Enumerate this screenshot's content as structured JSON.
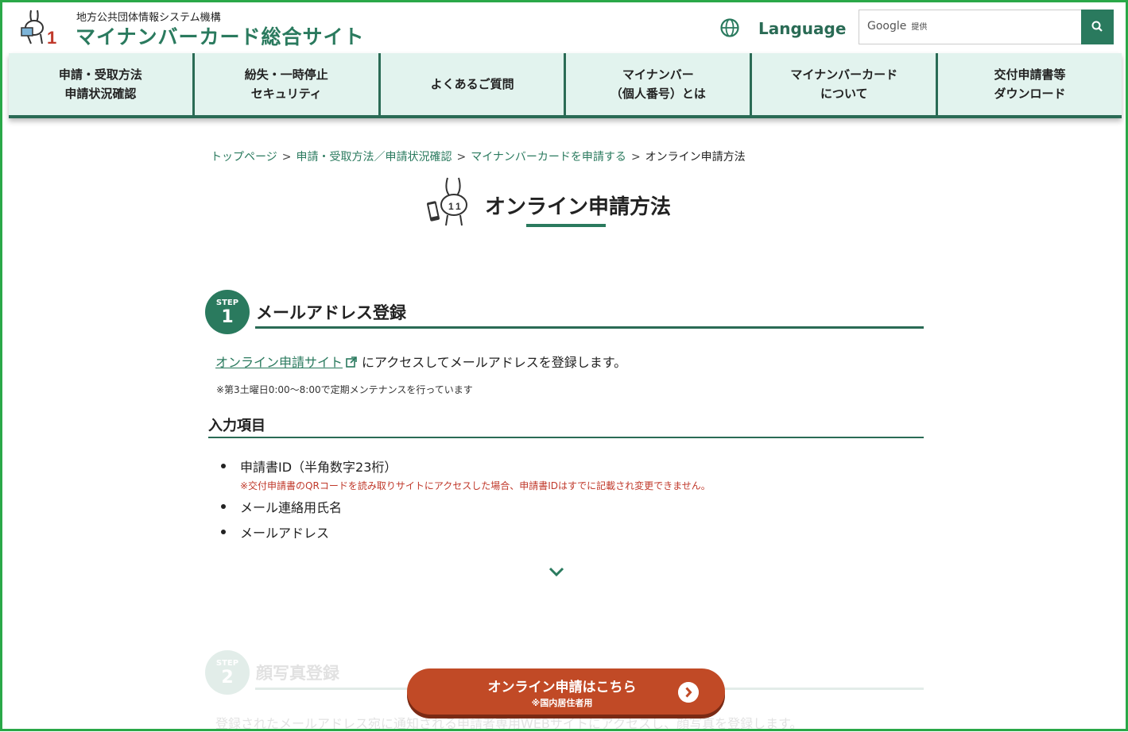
{
  "header": {
    "org_name": "地方公共団体情報システム機構",
    "site_name": "マイナンバーカード総合サイト",
    "language_label": "Language",
    "search_brand": "Google",
    "search_brand_suffix": "提供"
  },
  "nav": [
    {
      "line1": "申請・受取方法",
      "line2": "申請状況確認"
    },
    {
      "line1": "紛失・一時停止",
      "line2": "セキュリティ"
    },
    {
      "line1": "よくあるご質問",
      "line2": ""
    },
    {
      "line1": "マイナンバー",
      "line2": "（個人番号）とは"
    },
    {
      "line1": "マイナンバーカード",
      "line2": "について"
    },
    {
      "line1": "交付申請書等",
      "line2": "ダウンロード"
    }
  ],
  "breadcrumb": {
    "items": [
      "トップページ",
      "申請・受取方法／申請状況確認",
      "マイナンバーカードを申請する"
    ],
    "current": "オンライン申請方法",
    "separator": ">"
  },
  "page_title": "オンライン申請方法",
  "step1": {
    "badge_label": "STEP",
    "badge_number": "1",
    "title": "メールアドレス登録",
    "link_text": "オンライン申請サイト",
    "para_rest": "にアクセスしてメールアドレスを登録します。",
    "note": "※第3土曜日0:00〜8:00で定期メンテナンスを行っています",
    "input_title": "入力項目",
    "items": [
      {
        "text": "申請書ID（半角数字23桁）",
        "note": "※交付申請書のQRコードを読み取りサイトにアクセスした場合、申請書IDはすでに記載され変更できません。"
      },
      {
        "text": "メール連絡用氏名",
        "note": ""
      },
      {
        "text": "メールアドレス",
        "note": ""
      }
    ]
  },
  "step2": {
    "badge_label": "STEP",
    "badge_number": "2",
    "title": "顔写真登録",
    "para": "登録されたメールアドレス宛に通知される申請者専用WEBサイトにアクセスし、顔写真を登録します。"
  },
  "cta": {
    "main": "オンライン申請はこちら",
    "sub": "※国内居住者用"
  },
  "colors": {
    "brand": "#2a7a5e",
    "cta": "#c14a26",
    "nav_bg": "#e2f3ee",
    "warning_note": "#c0392b"
  }
}
